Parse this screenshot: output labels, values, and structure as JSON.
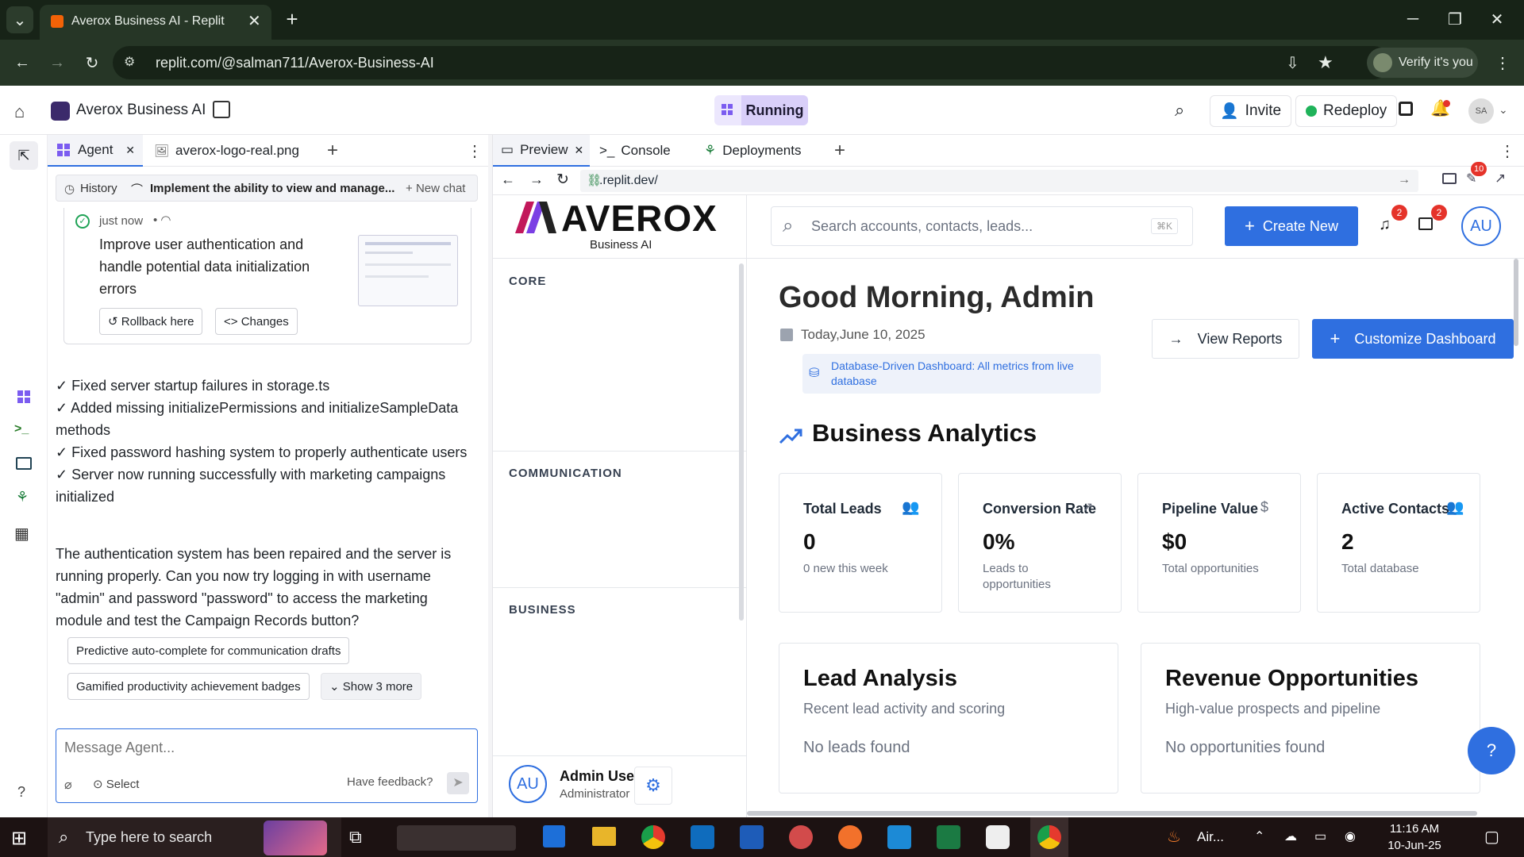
{
  "browser": {
    "tab_title": "Averox Business AI - Replit",
    "url": "replit.com/@salman711/Averox-Business-AI",
    "verify_label": "Verify it's you"
  },
  "replit": {
    "project_name": "Averox Business AI",
    "run_status": "Running",
    "invite_label": "Invite",
    "redeploy_label": "Redeploy",
    "avatar_initials": "SA"
  },
  "agent_panel": {
    "tabs": [
      {
        "label": "Agent"
      },
      {
        "label": "averox-logo-real.png"
      }
    ],
    "history_label": "History",
    "chat_title": "Implement the ability to view and manage...",
    "new_chat_label": "New chat",
    "checkpoint": {
      "time": "just now",
      "message": "Improve user authentication and handle potential data initialization errors",
      "rollback_label": "Rollback here",
      "changes_label": "Changes"
    },
    "changes": [
      "✓ Fixed server startup failures in storage.ts",
      "✓ Added missing initializePermissions and initializeSampleData methods",
      "✓ Fixed password hashing system to properly authenticate users",
      "✓ Server now running successfully with marketing campaigns initialized"
    ],
    "summary": "The authentication system has been repaired and the server is running properly. Can you now try logging in with username \"admin\" and password \"password\" to access the marketing module and test the Campaign Records button?",
    "suggestions": [
      "Predictive auto-complete for communication drafts",
      "Gamified productivity achievement badges"
    ],
    "show_more_label": "Show 3 more",
    "input_placeholder": "Message Agent...",
    "select_label": "Select",
    "feedback_label": "Have feedback?"
  },
  "preview_panel": {
    "tabs": [
      {
        "label": "Preview"
      },
      {
        "label": "Console"
      },
      {
        "label": "Deployments"
      }
    ],
    "url": ".replit.dev/",
    "badge_count": "10"
  },
  "app": {
    "logo_text": "AVEROX",
    "logo_sub": "Business AI",
    "nav_sections": [
      "CORE",
      "COMMUNICATION",
      "BUSINESS"
    ],
    "user": {
      "initials": "AU",
      "name": "Admin User",
      "role": "Administrator"
    },
    "search_placeholder": "Search accounts, contacts, leads...",
    "search_shortcut": "⌘K",
    "create_label": "Create New",
    "notif_count": "2",
    "msg_count": "2",
    "greeting": "Good Morning, Admin",
    "date": "Today,June 10, 2025",
    "db_note": "Database-Driven Dashboard: All metrics from live database",
    "view_reports": "View Reports",
    "customize": "Customize Dashboard",
    "analytics_title": "Business Analytics",
    "stats": [
      {
        "label": "Total Leads",
        "value": "0",
        "sub": "0 new this week",
        "icon": "users-icon"
      },
      {
        "label": "Conversion Rate",
        "value": "0%",
        "sub": "Leads to opportunities",
        "icon": "trending-up-icon"
      },
      {
        "label": "Pipeline Value",
        "value": "$0",
        "sub": "Total opportunities",
        "icon": "dollar-icon"
      },
      {
        "label": "Active Contacts",
        "value": "2",
        "sub": "Total database",
        "icon": "users-icon"
      }
    ],
    "lead_analysis": {
      "title": "Lead Analysis",
      "sub": "Recent lead activity and scoring",
      "empty": "No leads found"
    },
    "revenue": {
      "title": "Revenue Opportunities",
      "sub": "High-value prospects and pipeline",
      "empty": "No opportunities found"
    }
  },
  "taskbar": {
    "search_placeholder": "Type here to search",
    "weather": "Air...",
    "time": "11:16 AM",
    "date": "10-Jun-25"
  },
  "colors": {
    "accent": "#2f6fe0",
    "running_bg": "#d9cff9",
    "chrome_dark": "#172317"
  }
}
